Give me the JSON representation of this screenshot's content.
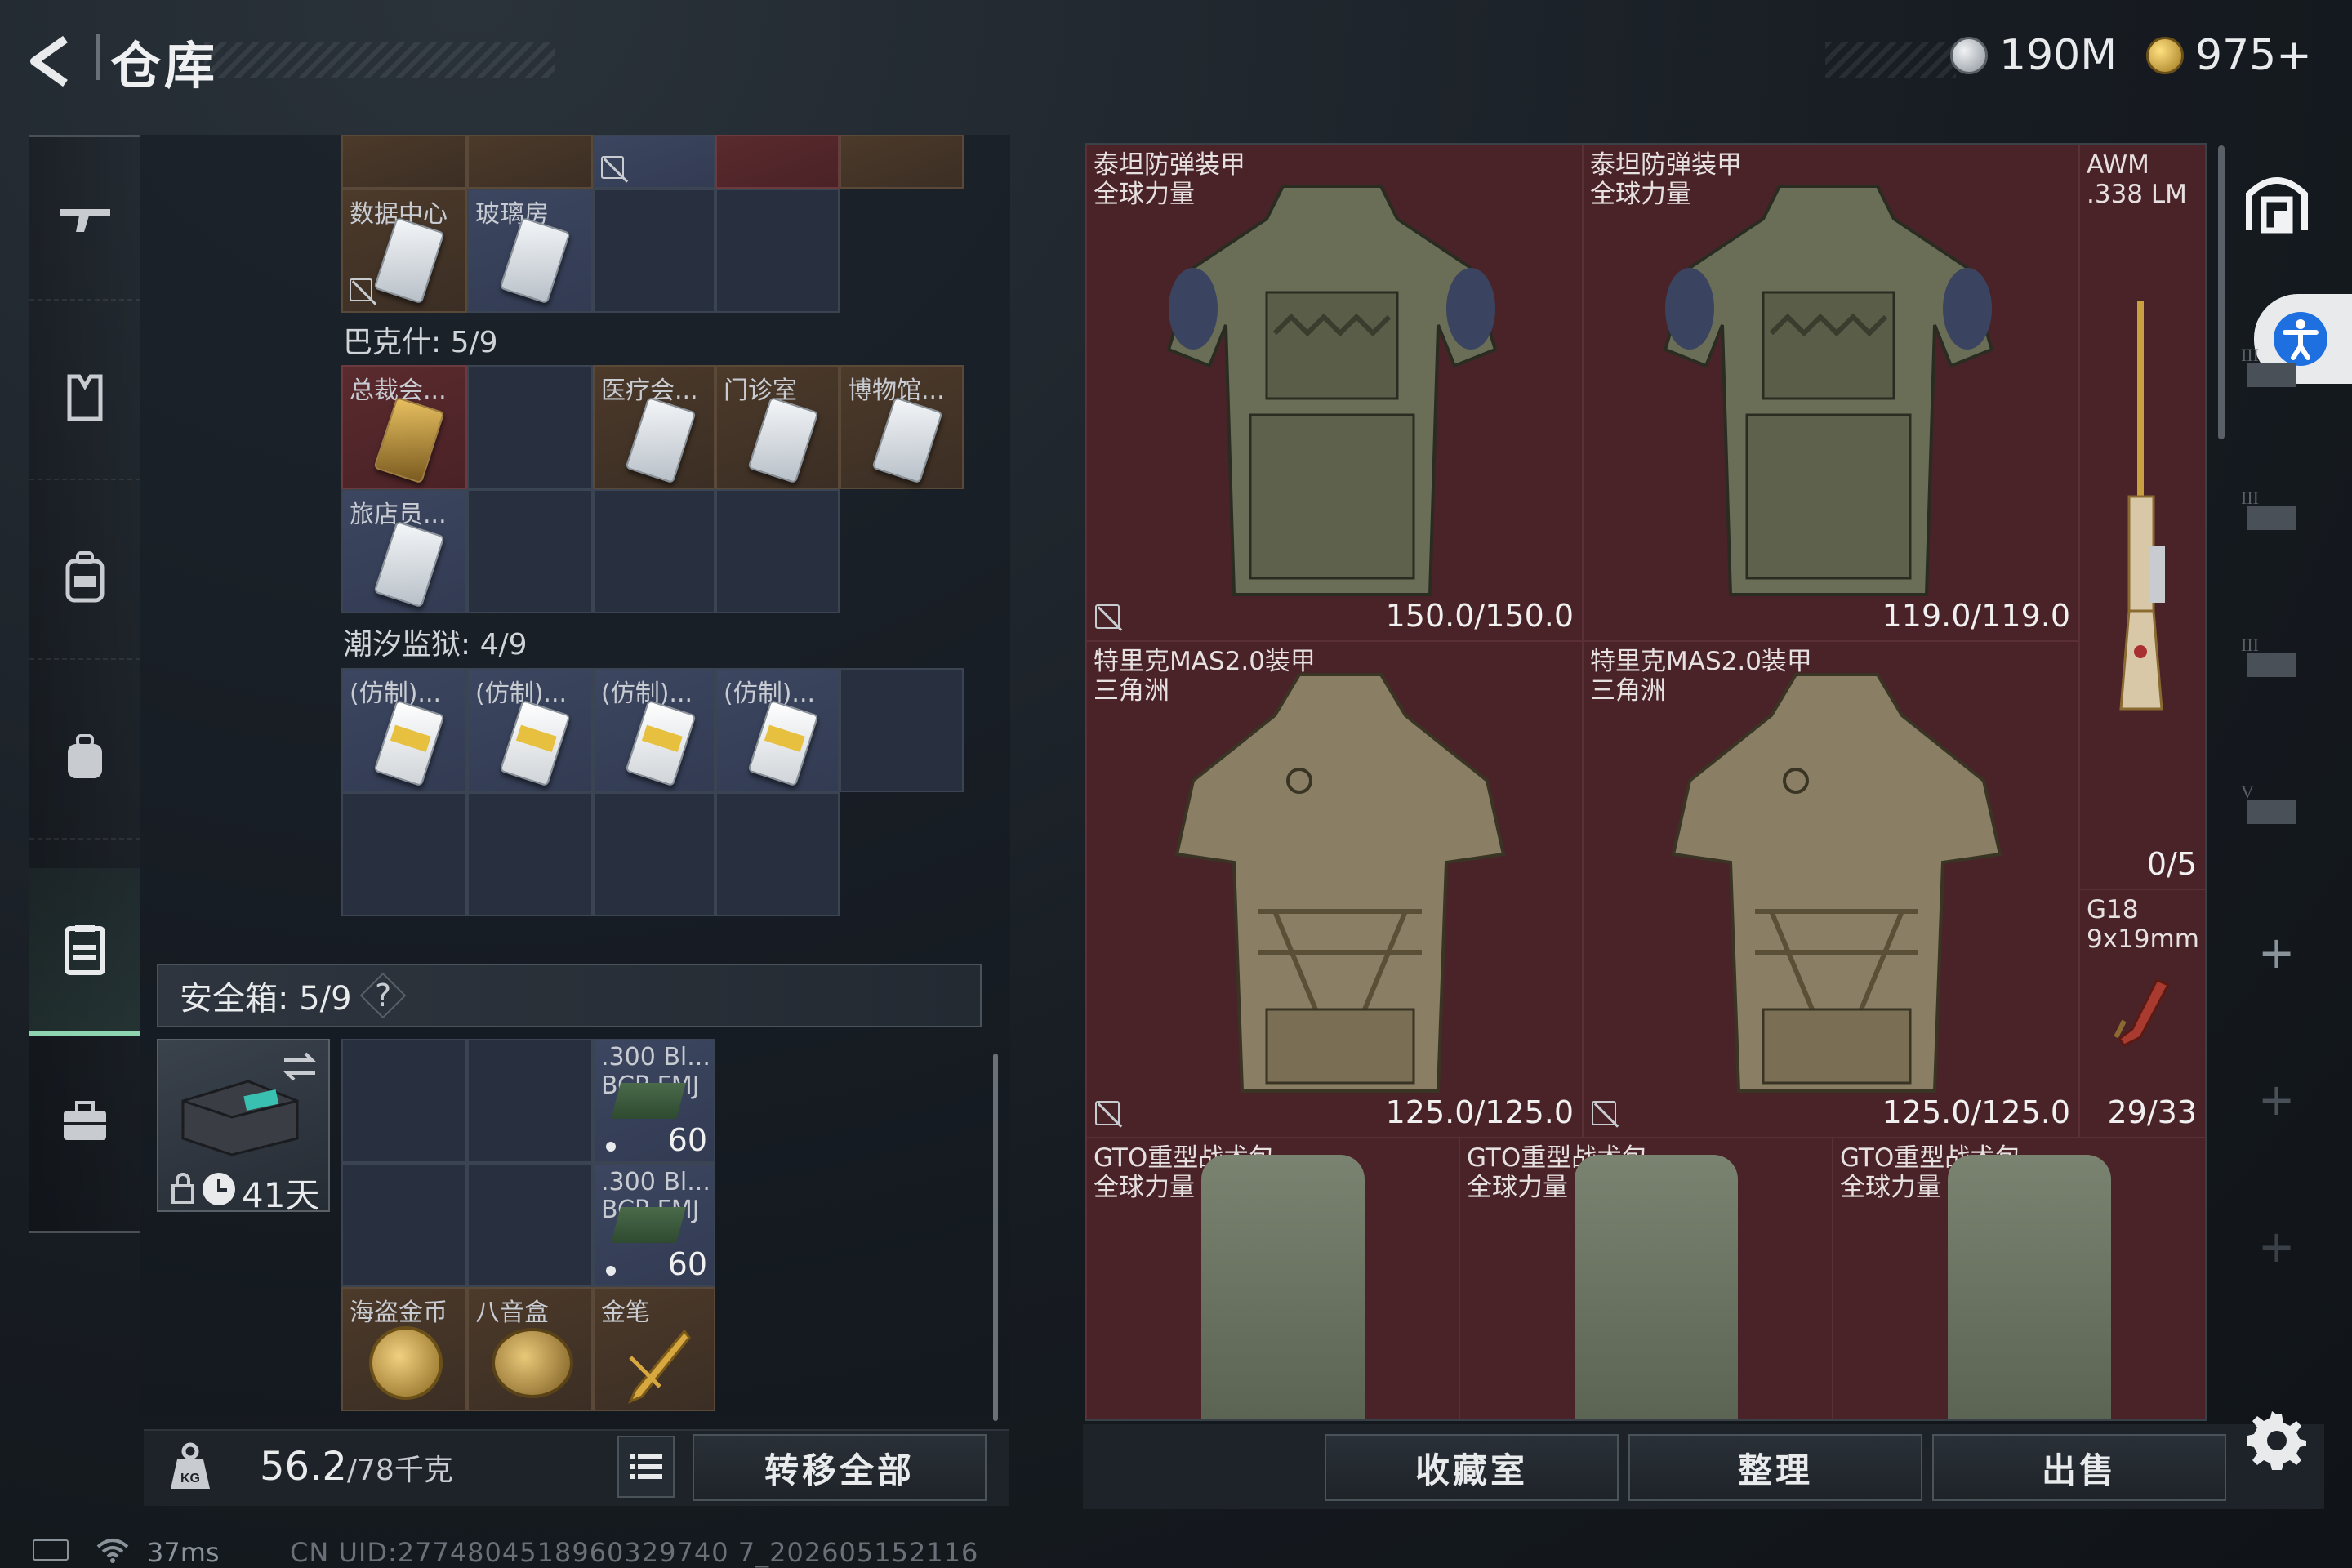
{
  "header": {
    "title": "仓库",
    "currency_silver": "190M",
    "currency_gold": "975+"
  },
  "sidebar": {
    "items": [
      {
        "icon": "rifle-icon"
      },
      {
        "icon": "armor-vest-icon"
      },
      {
        "icon": "backpack-icon"
      },
      {
        "icon": "bag-icon"
      },
      {
        "icon": "storage-box-icon",
        "active": true
      },
      {
        "icon": "briefcase-icon"
      }
    ]
  },
  "container": {
    "top_row_labels": [
      "数据中心",
      "玻璃房"
    ],
    "bakesh_title": "巴克什: 5/9",
    "bakesh_items": [
      "总裁会...",
      "医疗会...",
      "门诊室",
      "博物馆...",
      "旅店员..."
    ],
    "tide_title": "潮汐监狱: 4/9",
    "tide_items": [
      "(仿制)...",
      "(仿制)...",
      "(仿制)...",
      "(仿制)..."
    ]
  },
  "safebox": {
    "title": "安全箱: 5/9",
    "help": "?",
    "days": "41天",
    "ammo": [
      {
        "name": ".300 Bl...",
        "type": "BCP FMJ",
        "count": "60"
      },
      {
        "name": ".300 Bl...",
        "type": "BCP FMJ",
        "count": "60"
      }
    ],
    "valuables": [
      "海盗金币",
      "八音盒",
      "金笔"
    ]
  },
  "footer_left": {
    "weight_current": "56.2",
    "weight_total": "/78千克",
    "transfer_all": "转移全部"
  },
  "stash": {
    "armors": [
      {
        "name": "泰坦防弹装甲",
        "sub": "全球力量",
        "value": "150.0/150.0"
      },
      {
        "name": "泰坦防弹装甲",
        "sub": "全球力量",
        "value": "119.0/119.0"
      },
      {
        "name": "特里克MAS2.0装甲",
        "sub": "三角洲",
        "value": "125.0/125.0"
      },
      {
        "name": "特里克MAS2.0装甲",
        "sub": "三角洲",
        "value": "125.0/125.0"
      }
    ],
    "weapons": [
      {
        "name": "AWM",
        "sub": ".338 LM",
        "value": "0/5"
      },
      {
        "name": "G18",
        "sub": "9x19mm",
        "value": "29/33"
      }
    ],
    "bags": [
      {
        "name": "GTO重型战术包",
        "sub": "全球力量"
      },
      {
        "name": "GTO重型战术包",
        "sub": "全球力量"
      },
      {
        "name": "GTO重型战术包",
        "sub": "全球力量"
      }
    ]
  },
  "footer_right": {
    "collection": "收藏室",
    "sort": "整理",
    "sell": "出售"
  },
  "status": {
    "ping": "37ms",
    "uid": "CN UID:2774804518960329740 7_202605152116"
  }
}
